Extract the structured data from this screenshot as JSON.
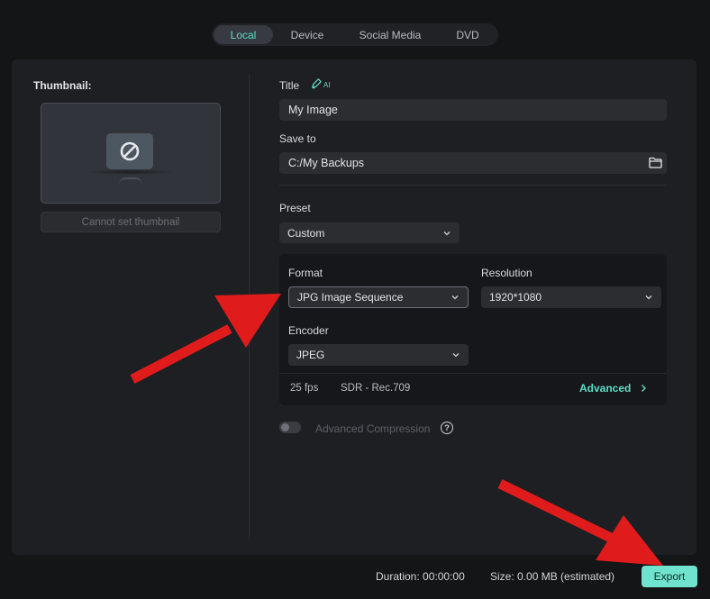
{
  "tabs": [
    {
      "label": "Local",
      "active": true
    },
    {
      "label": "Device",
      "active": false
    },
    {
      "label": "Social Media",
      "active": false
    },
    {
      "label": "DVD",
      "active": false
    }
  ],
  "thumbnail": {
    "label": "Thumbnail:",
    "button_label": "Cannot set thumbnail"
  },
  "title": {
    "label": "Title",
    "ai_icon": "ai-pen-icon",
    "ai_text": "AI",
    "value": "My Image"
  },
  "save_to": {
    "label": "Save to",
    "value": "C:/My Backups",
    "icon": "folder-icon"
  },
  "preset": {
    "label": "Preset",
    "value": "Custom"
  },
  "format": {
    "label": "Format",
    "value": "JPG Image Sequence"
  },
  "resolution": {
    "label": "Resolution",
    "value": "1920*1080"
  },
  "encoder": {
    "label": "Encoder",
    "value": "JPEG"
  },
  "info": {
    "fps": "25 fps",
    "color": "SDR - Rec.709",
    "advanced_label": "Advanced"
  },
  "compression": {
    "label": "Advanced Compression",
    "enabled": false,
    "help": "?"
  },
  "footer": {
    "duration": "Duration:  00:00:00",
    "size": "Size:  0.00 MB (estimated)",
    "export_label": "Export"
  },
  "colors": {
    "accent": "#6fe3cd",
    "arrow": "#e01b1b",
    "background": "#141517",
    "panel": "#1d1f22"
  }
}
